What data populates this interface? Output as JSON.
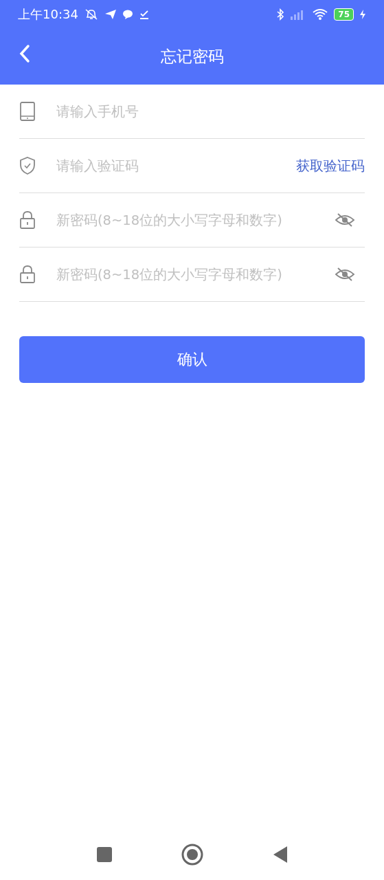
{
  "status_bar": {
    "time": "上午10:34",
    "battery": "75"
  },
  "header": {
    "title": "忘记密码"
  },
  "fields": [
    {
      "kind": "phone",
      "placeholder": "请输入手机号"
    },
    {
      "kind": "code",
      "placeholder": "请输入验证码",
      "action": "获取验证码"
    },
    {
      "kind": "password",
      "placeholder": "新密码(8~18位的大小写字母和数字)"
    },
    {
      "kind": "password",
      "placeholder": "新密码(8~18位的大小写字母和数字)"
    }
  ],
  "confirm_button": "确认"
}
